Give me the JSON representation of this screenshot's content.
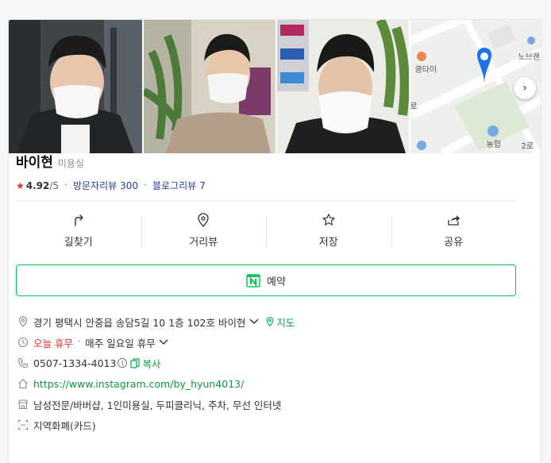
{
  "place": {
    "name": "바이현",
    "category": "미용실",
    "rating": "4.92",
    "rating_max": "/5",
    "visitor_reviews_label": "방문자리뷰",
    "visitor_reviews_count": "300",
    "blog_reviews_label": "블로그리뷰",
    "blog_reviews_count": "7"
  },
  "gallery": {
    "map_labels": [
      "노브랜",
      "쿵타이",
      "농협",
      "로",
      "2로"
    ]
  },
  "actions": [
    {
      "label": "길찾기",
      "icon": "directions-icon"
    },
    {
      "label": "거리뷰",
      "icon": "street-view-pin-icon"
    },
    {
      "label": "저장",
      "icon": "star-icon"
    },
    {
      "label": "공유",
      "icon": "share-icon"
    }
  ],
  "reserve": {
    "label": "예약",
    "icon": "naver-calendar-icon"
  },
  "details": {
    "address": "경기 평택시 안중읍 송담5길 10 1층 102호 바이현",
    "map_label": "지도",
    "status_today": "오늘 휴무",
    "regular_holiday": "매주 일요일 휴무",
    "phone": "0507-1334-4013",
    "copy_label": "복사",
    "website": "https://www.instagram.com/by_hyun4013/",
    "amenities": "남성전문/바버샵, 1인미용실, 두피클리닉, 주차, 무선 인터넷",
    "payment": "지역화폐(카드)"
  },
  "colors": {
    "naver_green": "#03c75a",
    "link_blue": "#26428b",
    "closed_red": "#e0312f",
    "map_pin": "#1a73e8"
  }
}
